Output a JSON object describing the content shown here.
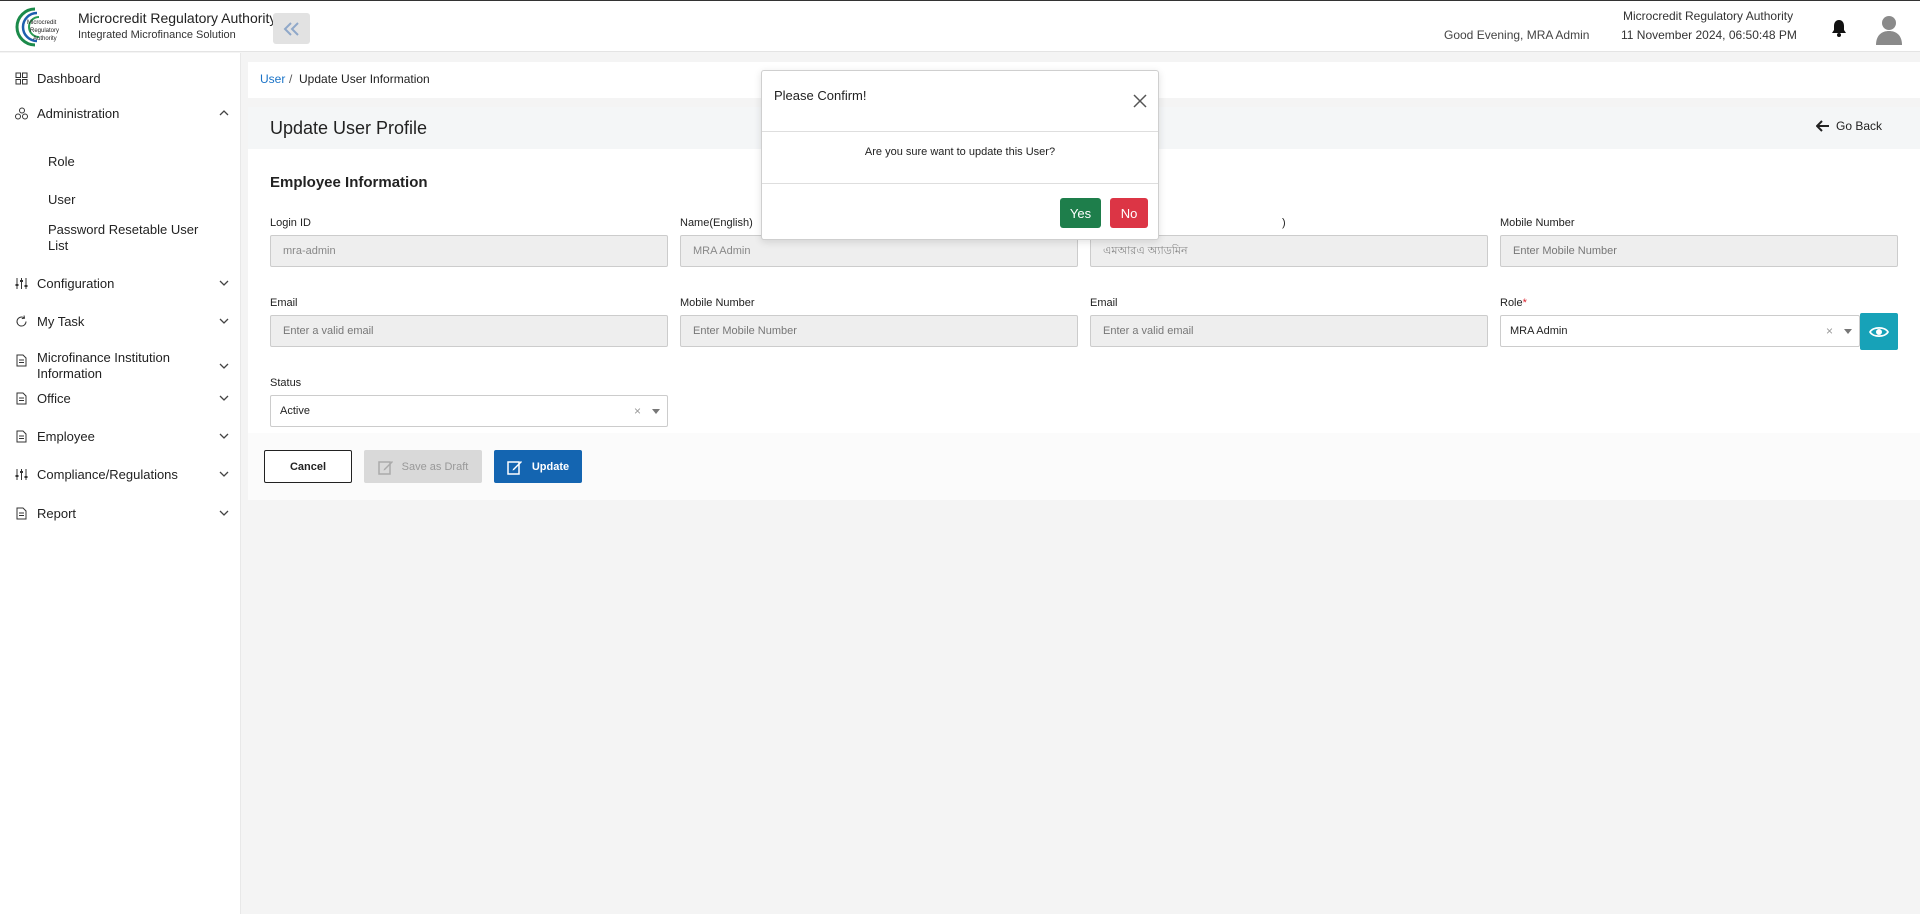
{
  "header": {
    "brand_title": "Microcredit Regulatory Authority",
    "brand_subtitle": "Integrated Microfinance Solution",
    "logo_text": "Microcredit Regulatory Authority",
    "greeting": "Good Evening, MRA Admin",
    "org_name": "Microcredit Regulatory Authority",
    "datetime": "11 November 2024, 06:50:48 PM"
  },
  "sidebar": {
    "items": [
      {
        "label": "Dashboard",
        "icon": "grid-icon"
      },
      {
        "label": "Administration",
        "icon": "users-icon",
        "expanded": true
      },
      {
        "label": "Configuration",
        "icon": "sliders-icon"
      },
      {
        "label": "My Task",
        "icon": "refresh-icon"
      },
      {
        "label": "Microfinance Institution Information",
        "icon": "document-icon"
      },
      {
        "label": "Office",
        "icon": "document-icon"
      },
      {
        "label": "Employee",
        "icon": "document-icon"
      },
      {
        "label": "Compliance/Regulations",
        "icon": "sliders-icon"
      },
      {
        "label": "Report",
        "icon": "document-icon"
      }
    ],
    "admin_subitems": [
      "Role",
      "User",
      "Password Resetable User List"
    ]
  },
  "breadcrumb": {
    "parent": "User",
    "separator": "/",
    "current": "Update User Information"
  },
  "page": {
    "title": "Update User Profile",
    "go_back": "Go Back",
    "section_title": "Employee Information"
  },
  "form": {
    "login_id": {
      "label": "Login ID",
      "value": "mra-admin"
    },
    "name_english": {
      "label": "Name(English)",
      "value": "MRA Admin"
    },
    "name_bangla": {
      "label": ")",
      "value": "এমআরএ অ্যাডমিন"
    },
    "mobile_1": {
      "label": "Mobile Number",
      "placeholder": "Enter Mobile Number"
    },
    "email_1": {
      "label": "Email",
      "placeholder": "Enter a valid email"
    },
    "mobile_2": {
      "label": "Mobile Number",
      "placeholder": "Enter Mobile Number"
    },
    "email_2": {
      "label": "Email",
      "placeholder": "Enter a valid email"
    },
    "role": {
      "label": "Role",
      "required": "*",
      "value": "MRA Admin",
      "clear": "×"
    },
    "status": {
      "label": "Status",
      "value": "Active",
      "clear": "×"
    }
  },
  "buttons": {
    "cancel": "Cancel",
    "save_draft": "Save as Draft",
    "update": "Update"
  },
  "modal": {
    "title": "Please Confirm!",
    "message": "Are you sure want to update this User?",
    "yes": "Yes",
    "no": "No"
  },
  "colors": {
    "primary": "#1465b1",
    "yes": "#1e7e4b",
    "no": "#dc3545",
    "info": "#17a2b8",
    "link": "#1a73c7"
  }
}
